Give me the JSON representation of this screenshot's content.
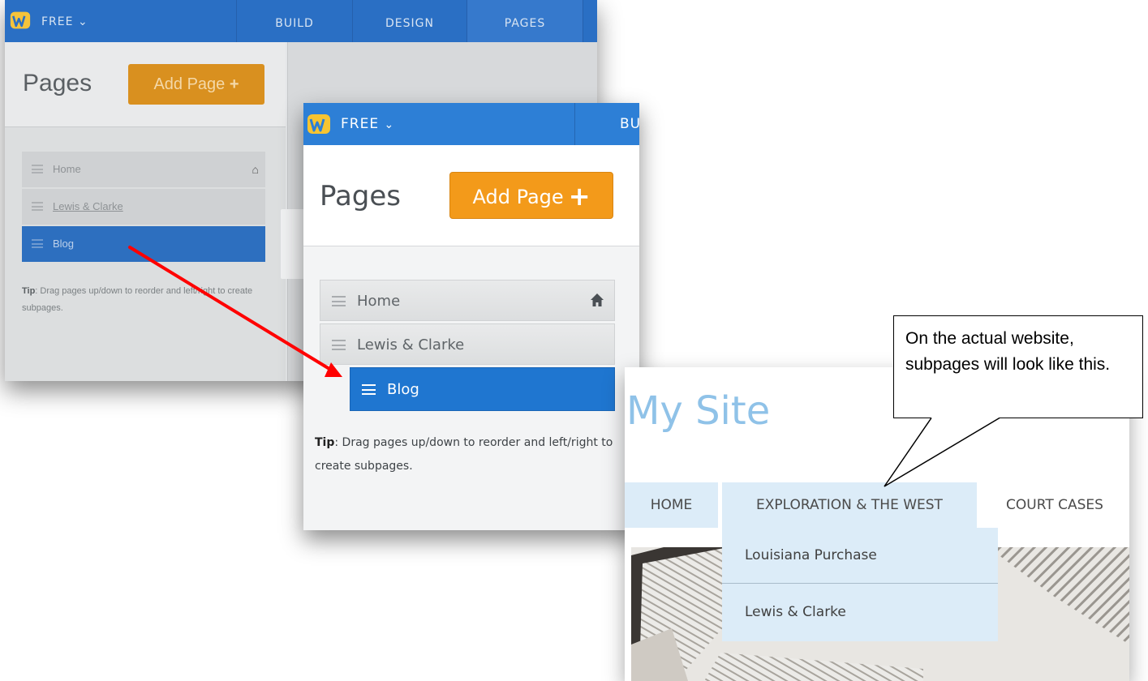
{
  "back_screenshot": {
    "plan_label": "FREE",
    "tabs": [
      "BUILD",
      "DESIGN",
      "PAGES"
    ],
    "selected_tab": "PAGES",
    "page_title": "Pages",
    "add_page_label": "Add Page",
    "pages": [
      {
        "label": "Home",
        "is_home": true,
        "selected": false
      },
      {
        "label": "Lewis & Clarke",
        "is_home": false,
        "selected": false
      },
      {
        "label": "Blog",
        "is_home": false,
        "selected": true
      }
    ],
    "tip_bold": "Tip",
    "tip_text": ": Drag pages up/down to reorder and left/right to create subpages."
  },
  "front_screenshot": {
    "plan_label": "FREE",
    "tab_partial": "BU",
    "page_title": "Pages",
    "add_page_label": "Add Page",
    "add_page_icon": "+",
    "pages": [
      {
        "label": "Home",
        "is_home": true
      },
      {
        "label": "Lewis & Clarke",
        "is_home": false
      },
      {
        "label": "Blog",
        "is_home": false,
        "selected": true,
        "subpage": true
      }
    ],
    "tip_bold": "Tip",
    "tip_text": ":  Drag pages up/down to reorder and left/right to create subpages."
  },
  "website": {
    "site_title": "My Site",
    "nav": [
      "HOME",
      "EXPLORATION & THE WEST",
      "COURT CASES"
    ],
    "dropdown": [
      "Louisiana Purchase",
      "Lewis & Clarke"
    ]
  },
  "callout": {
    "text": "On the actual website, subpages will look like this."
  },
  "colors": {
    "topbar_blue": "#2d7fd6",
    "add_page_orange": "#f39a1a",
    "selected_blue": "#1f76d0",
    "annotation_arrow": "#ff0000",
    "nav_highlight": "#dcecf8"
  },
  "icons": [
    "weebly-logo-icon",
    "chevron-down-icon",
    "menu-handle-icon",
    "home-icon",
    "plus-icon",
    "red-arrow-icon",
    "callout-pointer"
  ]
}
